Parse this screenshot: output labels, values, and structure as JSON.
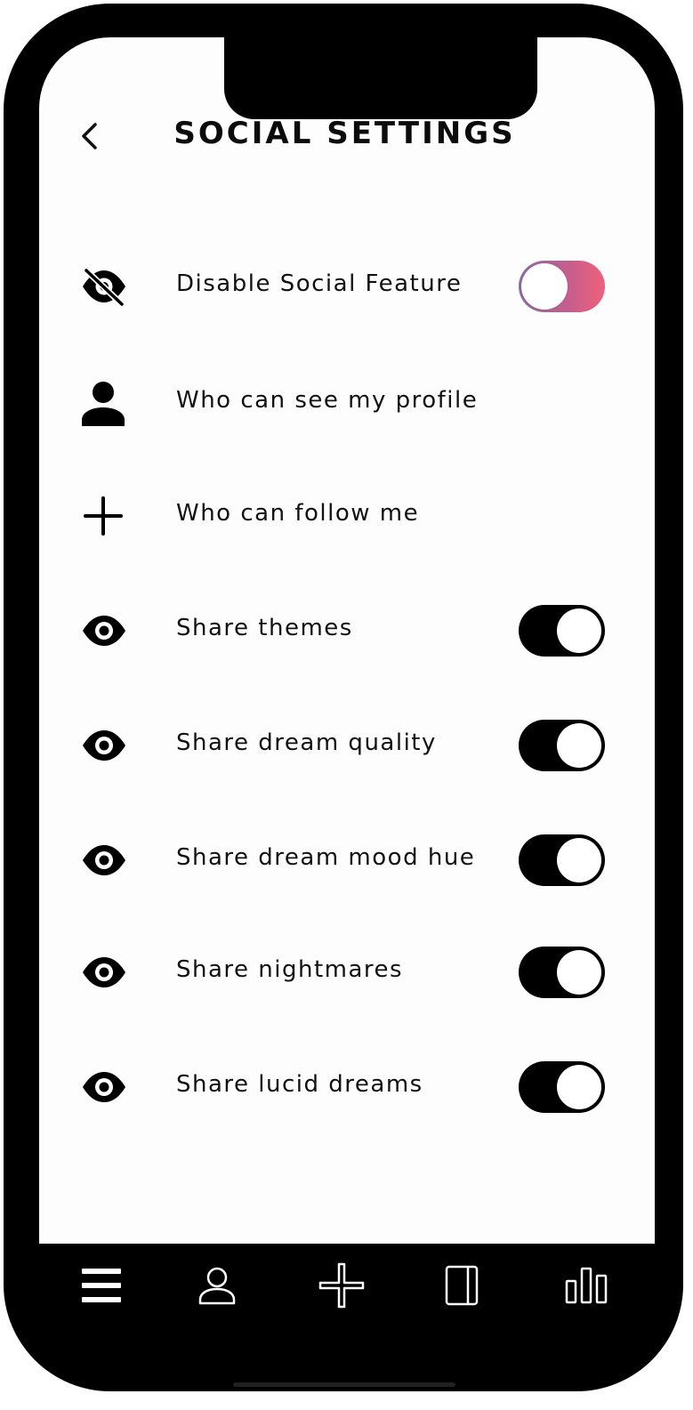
{
  "header": {
    "title": "SOCIAL SETTINGS",
    "back_icon": "chevron-left-icon"
  },
  "settings": [
    {
      "label": "Disable Social Feature",
      "icon": "eye-slash-icon",
      "control": "toggle",
      "state": "off",
      "accent": "#c45e8e"
    },
    {
      "label": "Who can see my profile",
      "icon": "person-icon",
      "control": "none"
    },
    {
      "label": "Who can follow me",
      "icon": "plus-icon",
      "control": "none"
    },
    {
      "label": "Share themes",
      "icon": "eye-icon",
      "control": "toggle",
      "state": "on"
    },
    {
      "label": "Share dream quality",
      "icon": "eye-icon",
      "control": "toggle",
      "state": "on"
    },
    {
      "label": "Share dream mood hue",
      "icon": "eye-icon",
      "control": "toggle",
      "state": "on"
    },
    {
      "label": "Share nightmares",
      "icon": "eye-icon",
      "control": "toggle",
      "state": "on"
    },
    {
      "label": "Share lucid dreams",
      "icon": "eye-icon",
      "control": "toggle",
      "state": "on"
    }
  ],
  "bottom_nav": [
    {
      "icon": "menu-icon"
    },
    {
      "icon": "profile-icon"
    },
    {
      "icon": "add-icon"
    },
    {
      "icon": "journal-icon"
    },
    {
      "icon": "stats-icon"
    }
  ],
  "colors": {
    "toggle_gradient_start": "#8a6aa6",
    "toggle_gradient_end": "#f0607a",
    "toggle_on": "#000000",
    "frame": "#000000"
  }
}
